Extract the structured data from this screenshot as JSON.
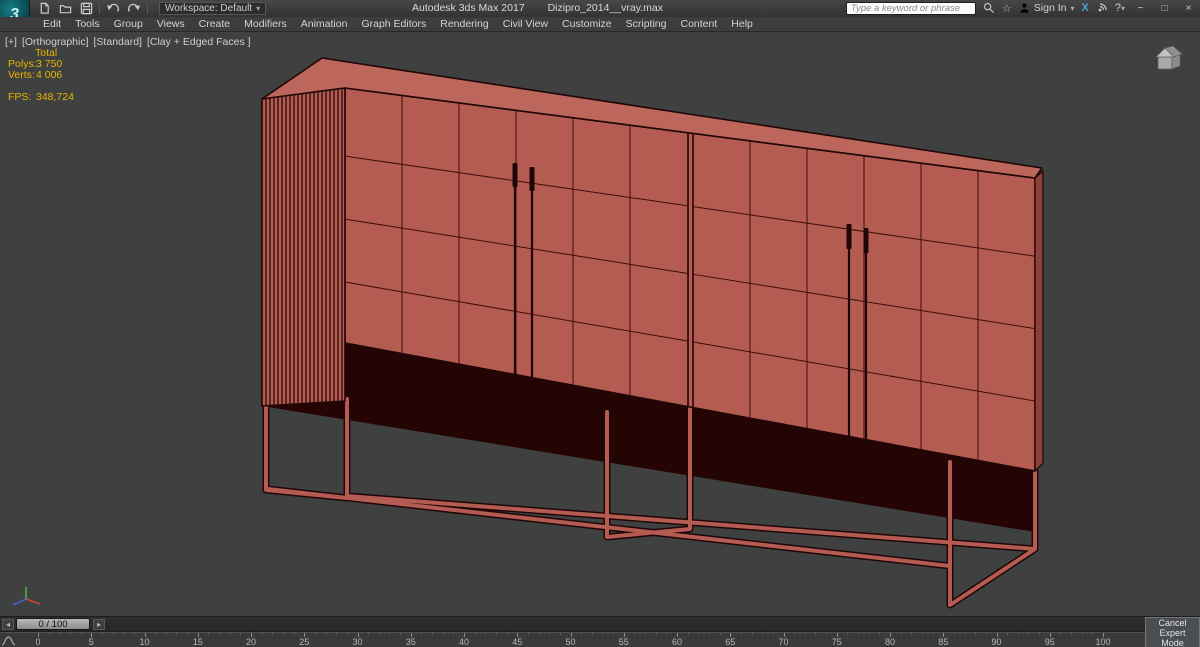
{
  "colors": {
    "titlebar_bg": "#3a3a3a",
    "menubar_bg": "#3d3d3d",
    "viewport_bg": "#3f4040",
    "model_fill": "#b45b52",
    "model_fill_light": "#bd665c",
    "model_fill_dark": "#8e4138",
    "model_edge": "#200606",
    "model_grid": "#3c0f0a",
    "under_shadow": "#250404",
    "stats_text": "#e7b400",
    "exchange_blue": "#45a4d6"
  },
  "title_bar": {
    "app_name": "Autodesk 3ds Max 2017",
    "file_name": "Dizipro_2014__vray.max",
    "workspace_label": "Workspace: Default",
    "search_placeholder": "Type a keyword or phrase",
    "sign_in_label": "Sign In",
    "exchange_label": "X",
    "help_label": "?",
    "window_controls": {
      "minimize": "−",
      "maximize": "□",
      "close": "×"
    }
  },
  "menu_bar": {
    "items": [
      "Edit",
      "Tools",
      "Group",
      "Views",
      "Create",
      "Modifiers",
      "Animation",
      "Graph Editors",
      "Rendering",
      "Civil View",
      "Customize",
      "Scripting",
      "Content",
      "Help"
    ]
  },
  "viewport": {
    "label_segments": [
      "[+]",
      "[Orthographic]",
      "[Standard]",
      "[Clay + Edged Faces ]"
    ],
    "statistics": {
      "total_label": "Total",
      "rows": [
        {
          "label": "Polys:",
          "value": "3 750"
        },
        {
          "label": "Verts:",
          "value": "4 006"
        }
      ],
      "fps_label": "FPS:",
      "fps_value": "348,724"
    }
  },
  "timeline": {
    "slider_value": "0 / 100",
    "tick_labels": [
      "0",
      "5",
      "10",
      "15",
      "20",
      "25",
      "30",
      "35",
      "40",
      "45",
      "50",
      "55",
      "60",
      "65",
      "70",
      "75",
      "80",
      "85",
      "90",
      "95",
      "100"
    ]
  },
  "expert_mode": {
    "line1": "Cancel Expert",
    "line2": "Mode"
  },
  "glyphs": {
    "app_logo": "3",
    "chevron_down": "▾",
    "slider_prev": "◂",
    "slider_next": "▸",
    "star": "☆"
  }
}
